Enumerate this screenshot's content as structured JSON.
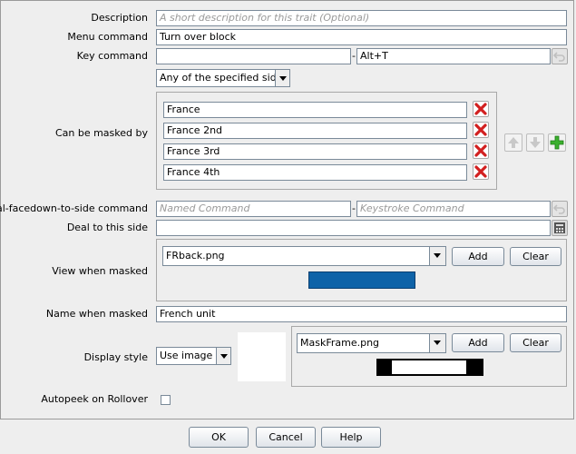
{
  "fields": {
    "description": {
      "label": "Description",
      "placeholder": "A short description for this trait (Optional)"
    },
    "menu_command": {
      "label": "Menu command",
      "value": "Turn over block"
    },
    "key_command": {
      "label": "Key command",
      "value": "",
      "separator": "-",
      "keystroke": "Alt+T"
    },
    "sides_combo": {
      "value": "Any of the specified sides"
    },
    "masked_by": {
      "label": "Can be masked by",
      "items": [
        "France",
        "France 2nd",
        "France 3rd",
        "France 4th"
      ]
    },
    "deal_command": {
      "label": "Deal-facedown-to-side command",
      "named_placeholder": "Named Command",
      "separator": "-",
      "keystroke_placeholder": "Keystroke Command"
    },
    "deal_side": {
      "label": "Deal to this side",
      "value": ""
    },
    "view_masked": {
      "label": "View when masked",
      "image": "FRback.png",
      "add": "Add",
      "clear": "Clear",
      "preview_color": "#0f63a8"
    },
    "name_masked": {
      "label": "Name when masked",
      "value": "French unit"
    },
    "display_style": {
      "label": "Display style",
      "value": "Use image",
      "image": "MaskFrame.png",
      "add": "Add",
      "clear": "Clear"
    },
    "autopeek": {
      "label": "Autopeek on Rollover",
      "checked": false
    }
  },
  "footer": {
    "ok": "OK",
    "cancel": "Cancel",
    "help": "Help"
  }
}
